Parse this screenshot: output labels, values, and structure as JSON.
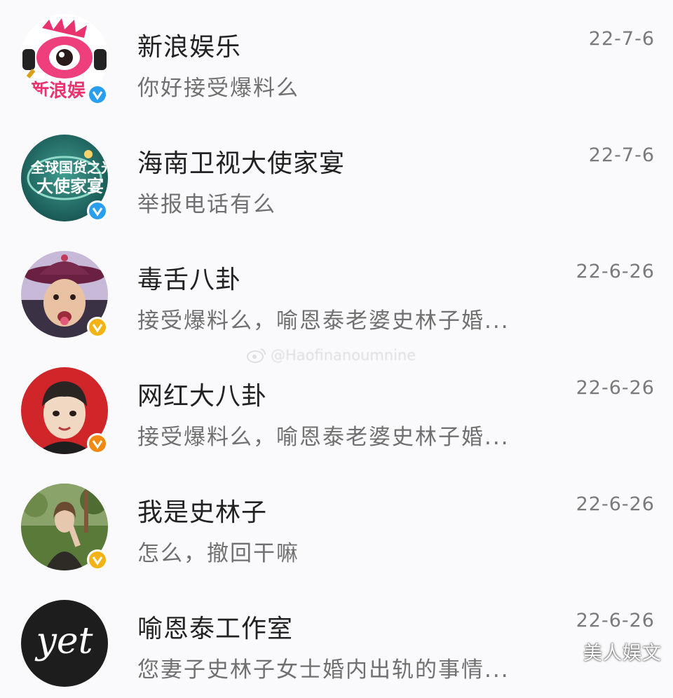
{
  "conversations": [
    {
      "name": "新浪娱乐",
      "preview": "你好接受爆料么",
      "date": "22-7-6",
      "badge": "blue",
      "avatar": "sina-ent-logo"
    },
    {
      "name": "海南卫视大使家宴",
      "preview": "举报电话有么",
      "date": "22-7-6",
      "badge": "blue",
      "avatar": "show-logo"
    },
    {
      "name": "毒舌八卦",
      "preview": "接受爆料么，喻恩泰老婆史林子婚...",
      "date": "22-6-26",
      "badge": "gold",
      "avatar": "cartoon-hat-face"
    },
    {
      "name": "网红大八卦",
      "preview": "接受爆料么，喻恩泰老婆史林子婚...",
      "date": "22-6-26",
      "badge": "orange",
      "avatar": "cartoon-boy"
    },
    {
      "name": "我是史林子",
      "preview": "怎么，撤回干嘛",
      "date": "22-6-26",
      "badge": "gold",
      "avatar": "photo-woman"
    },
    {
      "name": "喻恩泰工作室",
      "preview": "您妻子史林子女士婚内出轨的事情...",
      "date": "22-6-26",
      "badge": "none",
      "avatar": "yet-logo"
    }
  ],
  "avatar_text": {
    "yet": "yet"
  },
  "watermark": "@Haofinanoumnine",
  "brand_watermark": "美人娱文",
  "colors": {
    "blue_badge": "#2a9ff0",
    "gold_badge": "#f3b316",
    "orange_badge": "#f08a12",
    "background": "#fafafc"
  }
}
